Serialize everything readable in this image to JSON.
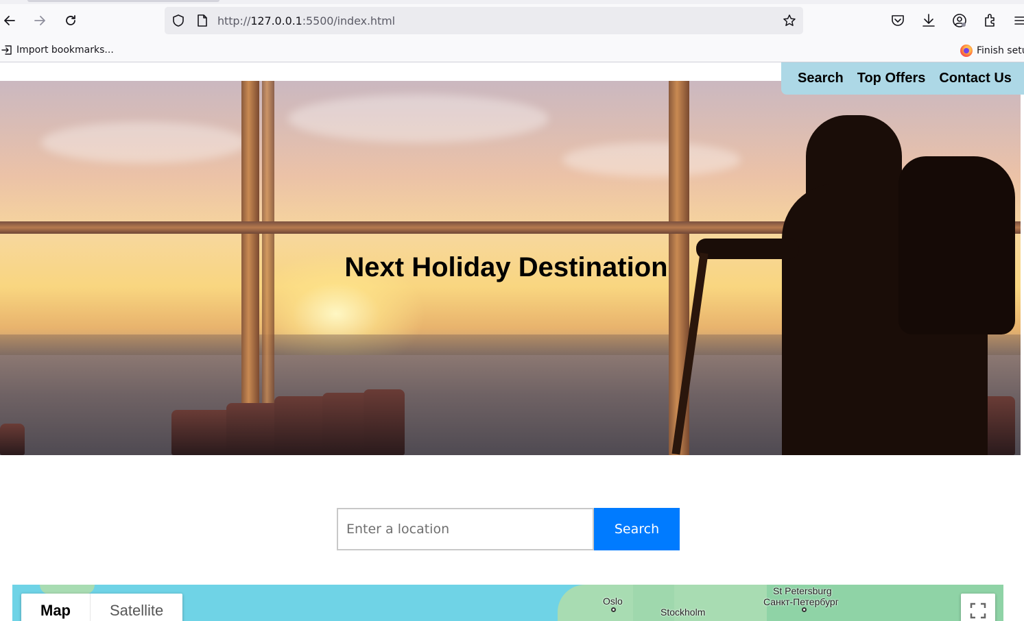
{
  "browser": {
    "url_prefix": "http://",
    "url_host": "127.0.0.1",
    "url_rest": ":5500/index.html",
    "bookmarks": {
      "import_label": "Import bookmarks...",
      "finish_label": "Finish setu"
    }
  },
  "nav": {
    "items": [
      {
        "label": "Search"
      },
      {
        "label": "Top Offers"
      },
      {
        "label": "Contact Us"
      }
    ]
  },
  "hero": {
    "title": "Next Holiday Destination"
  },
  "search": {
    "placeholder": "Enter a location",
    "button_label": "Search"
  },
  "map": {
    "tabs": [
      {
        "label": "Map",
        "active": true
      },
      {
        "label": "Satellite",
        "active": false
      }
    ],
    "places": [
      {
        "name": "Oslo"
      },
      {
        "name": "Stockholm"
      },
      {
        "name": "St Petersburg"
      },
      {
        "name": "Санкт-Петербург"
      }
    ]
  },
  "colors": {
    "nav_background": "#add8e6",
    "search_button": "#007bff",
    "map_water": "#6fd3e6"
  }
}
